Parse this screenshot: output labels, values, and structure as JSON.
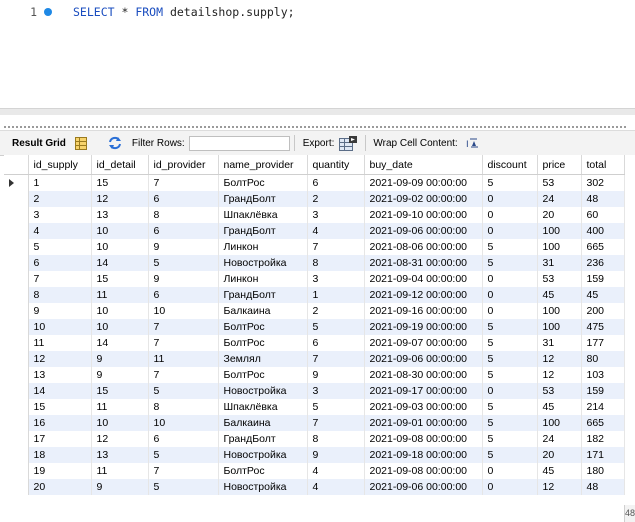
{
  "editor": {
    "line_number": "1",
    "keyword_select": "SELECT",
    "star": " * ",
    "keyword_from": "FROM",
    "table_ref": " detailshop.supply;"
  },
  "toolbar": {
    "result_grid_label": "Result Grid",
    "filter_rows_label": "Filter Rows:",
    "filter_rows_value": "",
    "export_label": "Export:",
    "wrap_cell_label": "Wrap Cell Content:"
  },
  "grid": {
    "columns": [
      "id_supply",
      "id_detail",
      "id_provider",
      "name_provider",
      "quantity",
      "buy_date",
      "discount",
      "price",
      "total"
    ],
    "rows": [
      [
        "1",
        "15",
        "7",
        "БолтРос",
        "6",
        "2021-09-09 00:00:00",
        "5",
        "53",
        "302"
      ],
      [
        "2",
        "12",
        "6",
        "ГрандБолт",
        "2",
        "2021-09-02 00:00:00",
        "0",
        "24",
        "48"
      ],
      [
        "3",
        "13",
        "8",
        "Шпаклёвка",
        "3",
        "2021-09-10 00:00:00",
        "0",
        "20",
        "60"
      ],
      [
        "4",
        "10",
        "6",
        "ГрандБолт",
        "4",
        "2021-09-06 00:00:00",
        "0",
        "100",
        "400"
      ],
      [
        "5",
        "10",
        "9",
        "Линкон",
        "7",
        "2021-08-06 00:00:00",
        "5",
        "100",
        "665"
      ],
      [
        "6",
        "14",
        "5",
        "Новостройка",
        "8",
        "2021-08-31 00:00:00",
        "5",
        "31",
        "236"
      ],
      [
        "7",
        "15",
        "9",
        "Линкон",
        "3",
        "2021-09-04 00:00:00",
        "0",
        "53",
        "159"
      ],
      [
        "8",
        "11",
        "6",
        "ГрандБолт",
        "1",
        "2021-09-12 00:00:00",
        "0",
        "45",
        "45"
      ],
      [
        "9",
        "10",
        "10",
        "Балкаина",
        "2",
        "2021-09-16 00:00:00",
        "0",
        "100",
        "200"
      ],
      [
        "10",
        "10",
        "7",
        "БолтРос",
        "5",
        "2021-09-19 00:00:00",
        "5",
        "100",
        "475"
      ],
      [
        "11",
        "14",
        "7",
        "БолтРос",
        "6",
        "2021-09-07 00:00:00",
        "5",
        "31",
        "177"
      ],
      [
        "12",
        "9",
        "11",
        "Землял",
        "7",
        "2021-09-06 00:00:00",
        "5",
        "12",
        "80"
      ],
      [
        "13",
        "9",
        "7",
        "БолтРос",
        "9",
        "2021-08-30 00:00:00",
        "5",
        "12",
        "103"
      ],
      [
        "14",
        "15",
        "5",
        "Новостройка",
        "3",
        "2021-09-17 00:00:00",
        "0",
        "53",
        "159"
      ],
      [
        "15",
        "11",
        "8",
        "Шпаклёвка",
        "5",
        "2021-09-03 00:00:00",
        "5",
        "45",
        "214"
      ],
      [
        "16",
        "10",
        "10",
        "Балкаина",
        "7",
        "2021-09-01 00:00:00",
        "5",
        "100",
        "665"
      ],
      [
        "17",
        "12",
        "6",
        "ГрандБолт",
        "8",
        "2021-09-08 00:00:00",
        "5",
        "24",
        "182"
      ],
      [
        "18",
        "13",
        "5",
        "Новостройка",
        "9",
        "2021-09-18 00:00:00",
        "5",
        "20",
        "171"
      ],
      [
        "19",
        "11",
        "7",
        "БолтРос",
        "4",
        "2021-09-08 00:00:00",
        "0",
        "45",
        "180"
      ],
      [
        "20",
        "9",
        "5",
        "Новостройка",
        "4",
        "2021-09-06 00:00:00",
        "0",
        "12",
        "48"
      ]
    ],
    "selected_row": 0
  },
  "edge_number": "48",
  "colors": {
    "keyword": "#1a4dbf",
    "breakpoint_dot": "#1e88e5",
    "row_alt": "#eaf0fb"
  },
  "icons": {
    "result_grid": "grid-icon",
    "refresh": "refresh-icon",
    "export": "export-icon",
    "wrap": "wrap-text-icon"
  }
}
